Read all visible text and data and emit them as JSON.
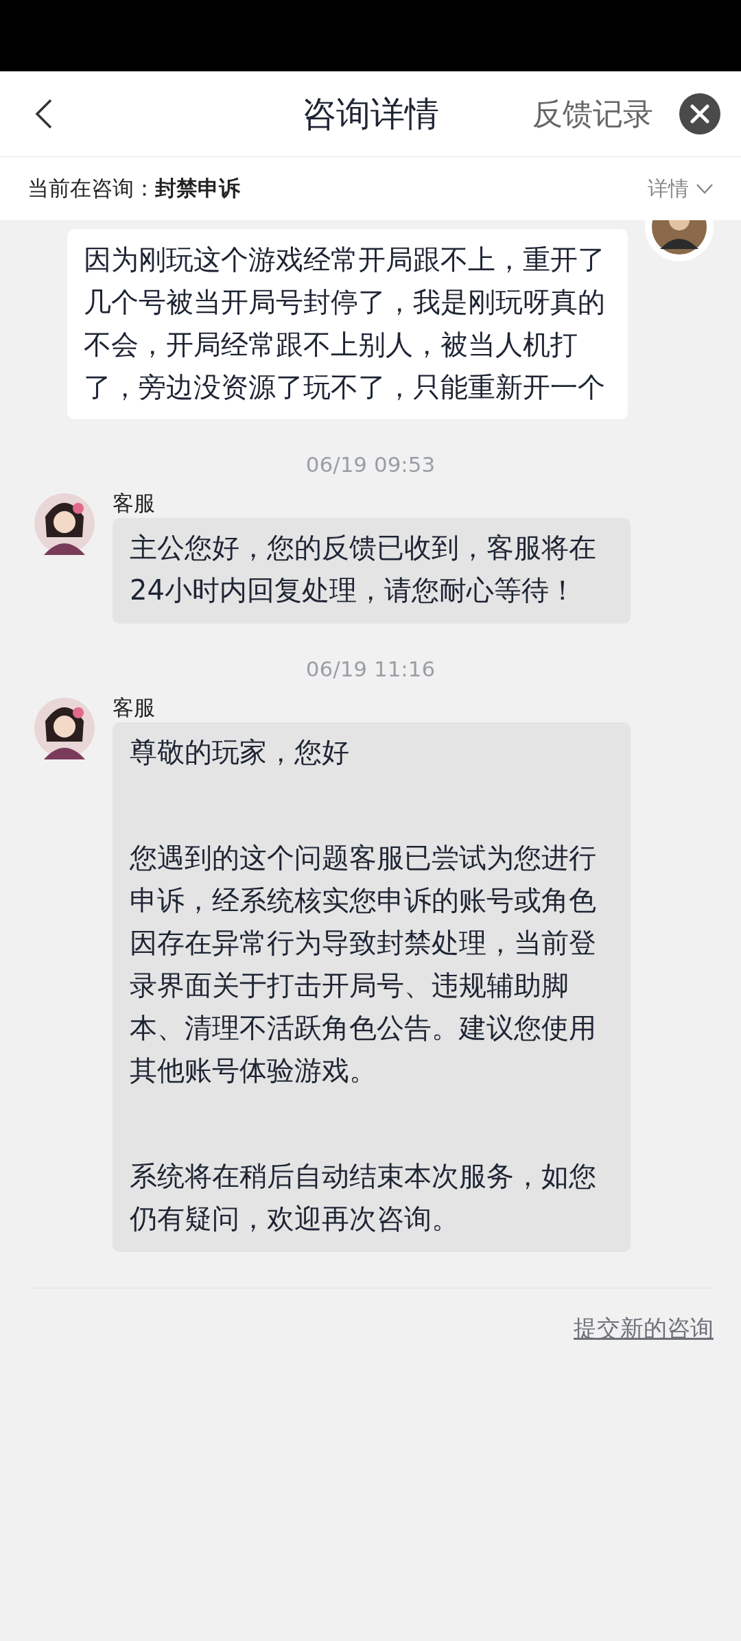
{
  "header": {
    "title": "咨询详情",
    "records_link": "反馈记录"
  },
  "topic_bar": {
    "label": "当前在咨询：",
    "topic": "封禁申诉",
    "details": "详情"
  },
  "messages": [
    {
      "kind": "user",
      "paragraphs": [
        "因为刚玩这个游戏经常开局跟不上，重开了几个号被当开局号封停了，我是刚玩呀真的不会，开局经常跟不上别人，被当人机打了，旁边没资源了玩不了，只能重新开一个"
      ]
    },
    {
      "kind": "agent",
      "time": "06/19 09:53",
      "sender": "客服",
      "paragraphs": [
        "主公您好，您的反馈已收到，客服将在24小时内回复处理，请您耐心等待！"
      ]
    },
    {
      "kind": "agent",
      "time": "06/19 11:16",
      "sender": "客服",
      "paragraphs": [
        "尊敬的玩家，您好",
        "您遇到的这个问题客服已尝试为您进行申诉，经系统核实您申诉的账号或角色因存在异常行为导致封禁处理，当前登录界面关于打击开局号、违规辅助脚本、清理不活跃角色公告。建议您使用其他账号体验游戏。",
        "系统将在稍后自动结束本次服务，如您仍有疑问，欢迎再次咨询。"
      ]
    }
  ],
  "new_inquiry_link": "提交新的咨询"
}
